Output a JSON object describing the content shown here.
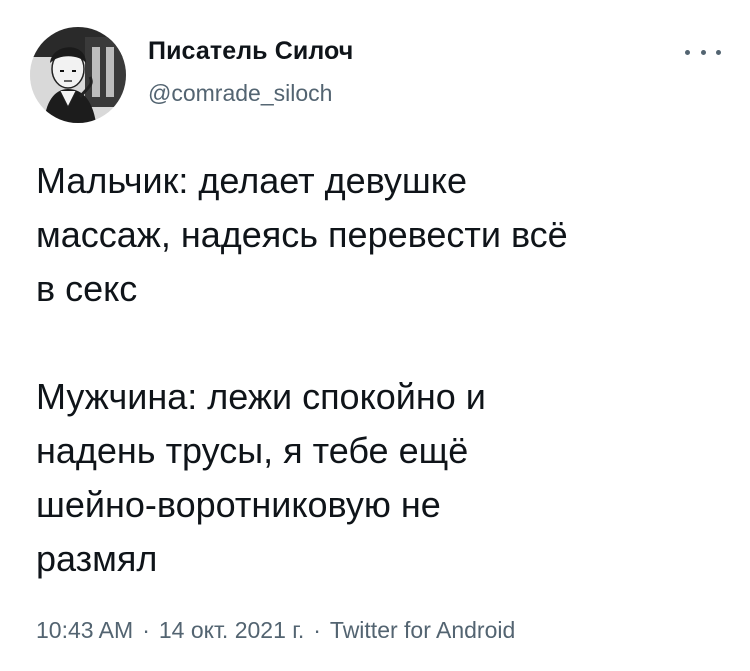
{
  "tweet": {
    "author": {
      "display_name": "Писатель Силоч",
      "handle": "@comrade_siloch",
      "avatar_icon": "avatar-portrait-icon"
    },
    "more_icon": "more-dots-icon",
    "body_lines": [
      "Мальчик: делает девушке",
      "массаж, надеясь перевести всё",
      "в секс",
      "",
      "Мужчина: лежи спокойно и",
      "надень трусы, я тебе ещё",
      "шейно-воротниковую не",
      "размял"
    ],
    "meta": {
      "time": "10:43 AM",
      "date": "14 окт. 2021 г.",
      "source": "Twitter for Android",
      "separator": "·"
    }
  }
}
